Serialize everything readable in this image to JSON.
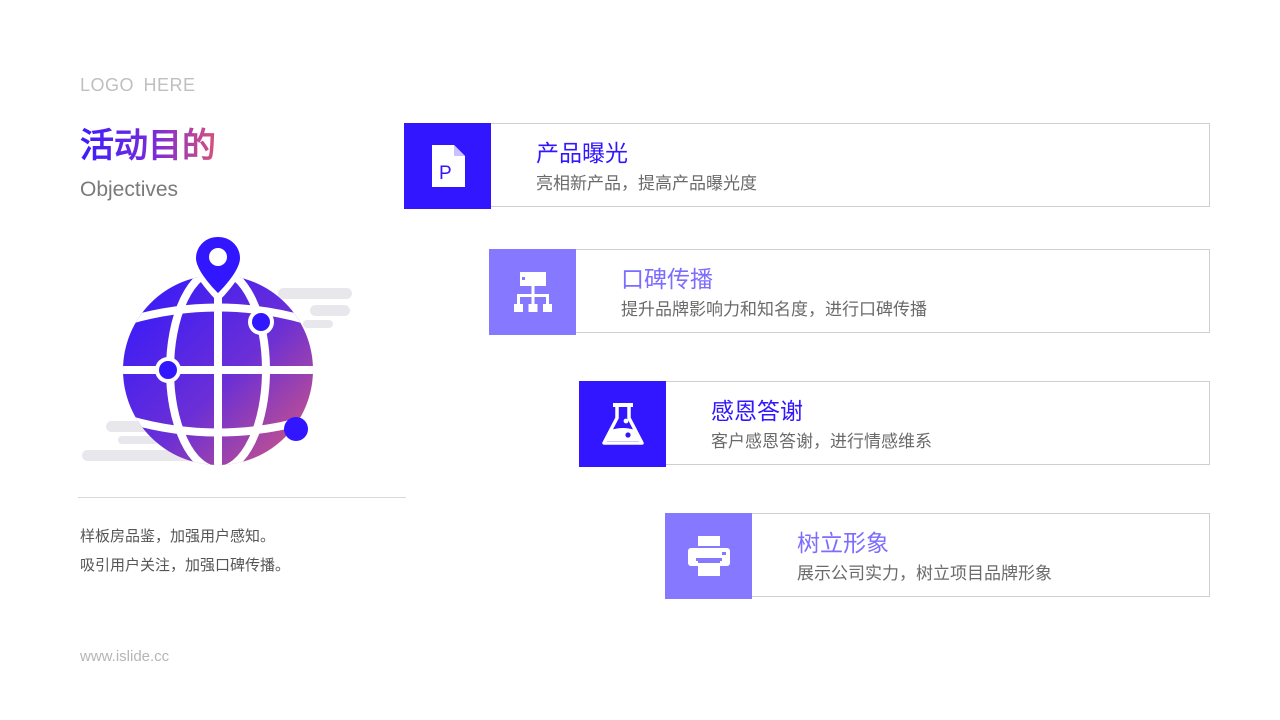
{
  "logo_text": "LOGO  HERE",
  "title": "活动目的",
  "subtitle": "Objectives",
  "description": [
    "样板房品鉴，加强用户感知。",
    "吸引用户关注，加强口碑传播。"
  ],
  "footer": "www.islide.cc",
  "colors": {
    "primary": "#3216ff",
    "secondary": "#8679ff",
    "gradient_end": "#d6527a"
  },
  "hero_icon": "globe-with-location-pin",
  "items": [
    {
      "title": "产品曝光",
      "desc": "亮相新产品，提高产品曝光度",
      "icon": "document-p-icon",
      "style": "primary"
    },
    {
      "title": "口碑传播",
      "desc": "提升品牌影响力和知名度，进行口碑传播",
      "icon": "sitemap-icon",
      "style": "secondary"
    },
    {
      "title": "感恩答谢",
      "desc": "客户感恩答谢，进行情感维系",
      "icon": "flask-icon",
      "style": "primary"
    },
    {
      "title": "树立形象",
      "desc": "展示公司实力，树立项目品牌形象",
      "icon": "printer-icon",
      "style": "secondary"
    }
  ]
}
